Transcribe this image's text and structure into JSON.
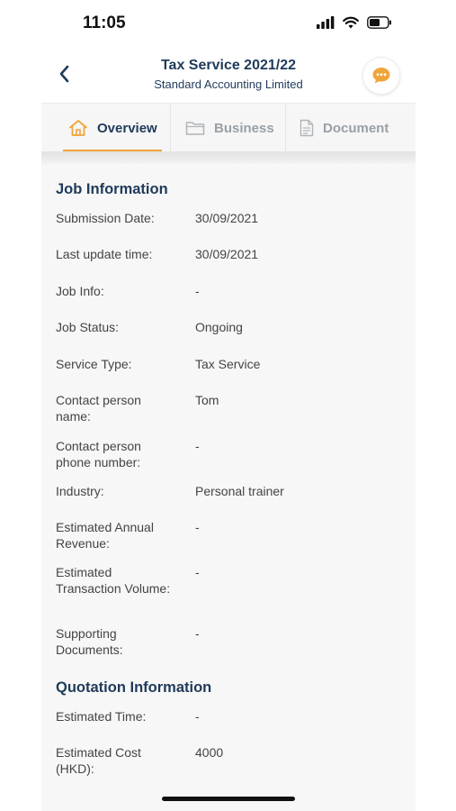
{
  "status_bar": {
    "time": "11:05"
  },
  "header": {
    "title": "Tax Service 2021/22",
    "subtitle": "Standard Accounting Limited"
  },
  "tabs": [
    {
      "label": "Overview",
      "icon": "home-icon",
      "active": true
    },
    {
      "label": "Business",
      "icon": "folder-icon",
      "active": false
    },
    {
      "label": "Document",
      "icon": "document-icon",
      "active": false
    }
  ],
  "job_information": {
    "title": "Job Information",
    "rows": [
      {
        "label": "Submission Date:",
        "value": "30/09/2021"
      },
      {
        "label": "Last update time:",
        "value": "30/09/2021"
      },
      {
        "label": "Job Info:",
        "value": "-"
      },
      {
        "label": "Job Status:",
        "value": "Ongoing"
      },
      {
        "label": "Service Type:",
        "value": "Tax Service"
      },
      {
        "label": "Contact person name:",
        "value": "Tom"
      },
      {
        "label": "Contact person phone number:",
        "value": "-"
      },
      {
        "label": "Industry:",
        "value": "Personal trainer"
      },
      {
        "label": "Estimated Annual Revenue:",
        "value": "-"
      },
      {
        "label": "Estimated Transaction Volume:",
        "value": "-"
      },
      {
        "label": "Supporting Documents:",
        "value": "-"
      }
    ]
  },
  "quotation_information": {
    "title": "Quotation Information",
    "rows": [
      {
        "label": "Estimated Time:",
        "value": "-"
      },
      {
        "label": "Estimated Cost (HKD):",
        "value": "4000"
      }
    ]
  },
  "colors": {
    "accent": "#f0a53a",
    "heading": "#1f3a5a",
    "muted_tab": "#9aa0a6"
  }
}
